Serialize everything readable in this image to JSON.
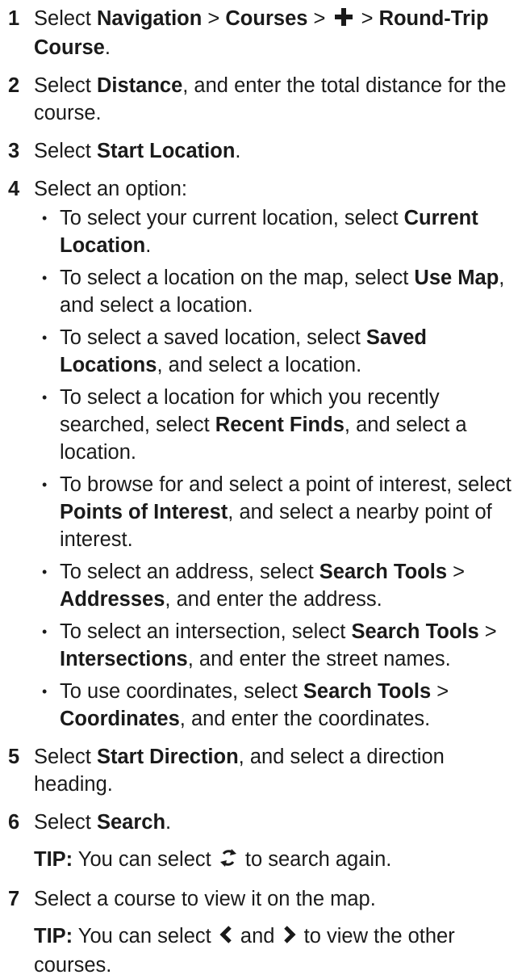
{
  "steps": [
    {
      "num": "1",
      "parts": [
        {
          "t": "Select "
        },
        {
          "t": "Navigation",
          "b": true
        },
        {
          "t": " > "
        },
        {
          "t": "Courses",
          "b": true
        },
        {
          "t": " > "
        },
        {
          "icon": "plus-icon"
        },
        {
          "t": " > "
        },
        {
          "t": "Round-Trip Course",
          "b": true
        },
        {
          "t": "."
        }
      ]
    },
    {
      "num": "2",
      "parts": [
        {
          "t": "Select "
        },
        {
          "t": "Distance",
          "b": true
        },
        {
          "t": ", and enter the total distance for the course."
        }
      ]
    },
    {
      "num": "3",
      "parts": [
        {
          "t": "Select "
        },
        {
          "t": "Start Location",
          "b": true
        },
        {
          "t": "."
        }
      ]
    },
    {
      "num": "4",
      "parts": [
        {
          "t": "Select an option:"
        }
      ],
      "options": [
        [
          {
            "t": "To select your current location, select "
          },
          {
            "t": "Current Location",
            "b": true
          },
          {
            "t": "."
          }
        ],
        [
          {
            "t": "To select a location on the map, select "
          },
          {
            "t": "Use Map",
            "b": true
          },
          {
            "t": ", and select a location."
          }
        ],
        [
          {
            "t": "To select a saved location, select "
          },
          {
            "t": "Saved Locations",
            "b": true
          },
          {
            "t": ", and select a location."
          }
        ],
        [
          {
            "t": "To select a location for which you recently searched, select "
          },
          {
            "t": "Recent Finds",
            "b": true
          },
          {
            "t": ", and select a location."
          }
        ],
        [
          {
            "t": "To browse for and select a point of interest, select "
          },
          {
            "t": "Points of Interest",
            "b": true
          },
          {
            "t": ", and select a nearby point of interest."
          }
        ],
        [
          {
            "t": "To select an address, select "
          },
          {
            "t": "Search Tools",
            "b": true
          },
          {
            "t": " > "
          },
          {
            "t": "Addresses",
            "b": true
          },
          {
            "t": ", and enter the address."
          }
        ],
        [
          {
            "t": "To select an intersection, select "
          },
          {
            "t": "Search Tools",
            "b": true
          },
          {
            "t": " > "
          },
          {
            "t": "Intersections",
            "b": true
          },
          {
            "t": ", and enter the street names."
          }
        ],
        [
          {
            "t": "To use coordinates, select "
          },
          {
            "t": "Search Tools",
            "b": true
          },
          {
            "t": " > "
          },
          {
            "t": "Coordinates",
            "b": true
          },
          {
            "t": ", and enter the coordinates."
          }
        ]
      ]
    },
    {
      "num": "5",
      "parts": [
        {
          "t": "Select "
        },
        {
          "t": "Start Direction",
          "b": true
        },
        {
          "t": ", and select a direction heading."
        }
      ]
    },
    {
      "num": "6",
      "parts": [
        {
          "t": "Select "
        },
        {
          "t": "Search",
          "b": true
        },
        {
          "t": "."
        }
      ],
      "tip": [
        {
          "t": "TIP:",
          "b": true
        },
        {
          "t": " You can select "
        },
        {
          "icon": "refresh-icon"
        },
        {
          "t": " to search again."
        }
      ]
    },
    {
      "num": "7",
      "parts": [
        {
          "t": "Select a course to view it on the map."
        }
      ],
      "tip": [
        {
          "t": "TIP:",
          "b": true
        },
        {
          "t": " You can select "
        },
        {
          "icon": "chevron-left-icon"
        },
        {
          "t": " and "
        },
        {
          "icon": "chevron-right-icon"
        },
        {
          "t": " to view the other courses."
        }
      ]
    }
  ],
  "bullet": "•"
}
